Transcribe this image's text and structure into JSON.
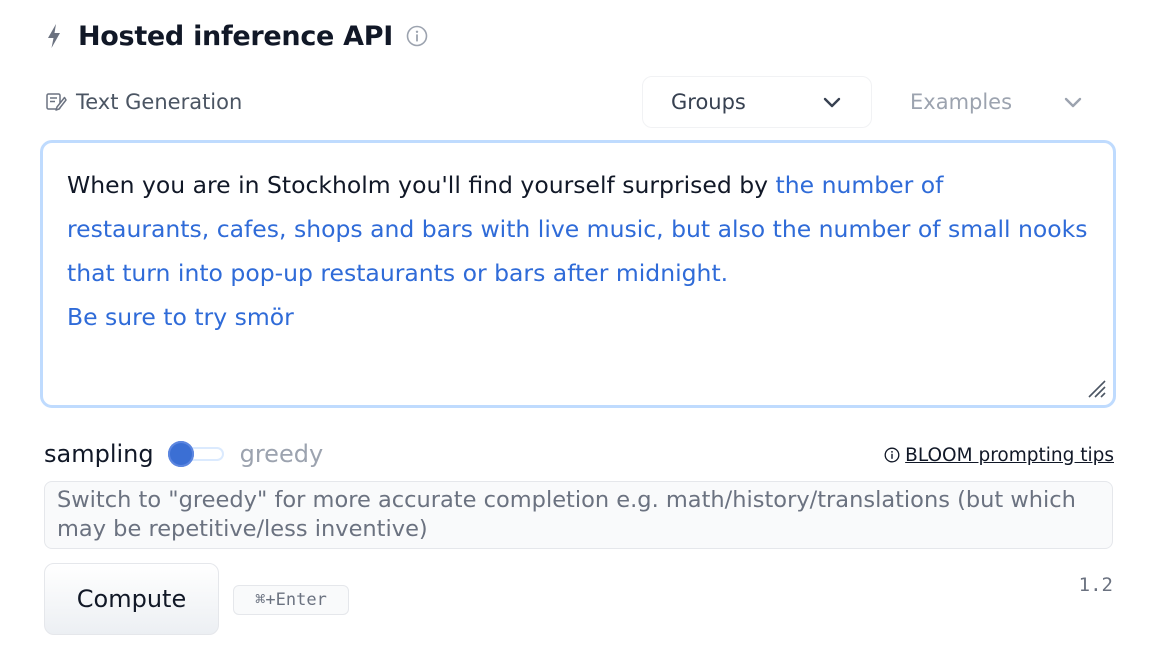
{
  "header": {
    "title": "Hosted inference API",
    "icons": {
      "bolt": "bolt-icon",
      "info": "info-icon"
    }
  },
  "task": {
    "label": "Text Generation",
    "icon": "text-edit-icon"
  },
  "selectors": {
    "groups": {
      "label": "Groups",
      "icon": "chevron-down-icon"
    },
    "examples": {
      "label": "Examples",
      "icon": "chevron-down-icon"
    }
  },
  "editor": {
    "prompt_text": "When you are in Stockholm you'll find yourself surprised by ",
    "generated_text": "the number of restaurants, cafes, shops and bars with live music, but also the number of small nooks that turn into pop-up restaurants or bars after midnight.\nBe sure to try smör",
    "colors": {
      "prompt": "#111827",
      "generated": "#2f6bd8",
      "focus_border": "#bfdbfe"
    }
  },
  "decoding": {
    "left_label": "sampling",
    "right_label": "greedy",
    "selected": "sampling"
  },
  "tips": {
    "label": "BLOOM prompting tips",
    "icon": "info-icon"
  },
  "hint": {
    "text": "Switch to \"greedy\" for more accurate completion e.g. math/history/translations (but which may be repetitive/less inventive)"
  },
  "actions": {
    "compute_label": "Compute",
    "shortcut": "⌘+Enter",
    "version": "1.2"
  }
}
